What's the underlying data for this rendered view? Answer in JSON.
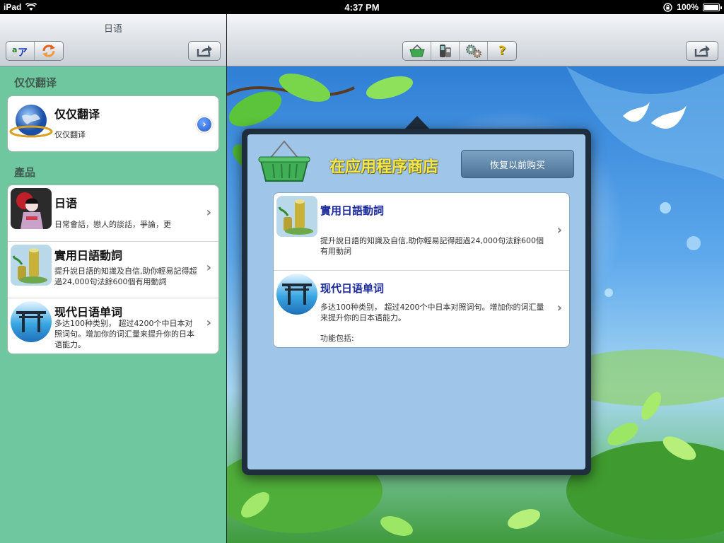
{
  "status_bar": {
    "device": "iPad",
    "time": "4:37 PM",
    "battery": "100%",
    "battery_level": 1.0
  },
  "master": {
    "title": "日语",
    "buttons": {
      "translate_icon": "translate-icon",
      "refresh_icon": "refresh-icon",
      "share_icon": "share-icon"
    },
    "sections": [
      {
        "header": "仅仅翻译",
        "items": [
          {
            "title": "仅仅翻译",
            "desc": "仅仅翻译",
            "icon": "globe-icon"
          }
        ]
      },
      {
        "header": "產品",
        "items": [
          {
            "title": "日语",
            "desc": "日常會話，戀人的談話，爭論，更",
            "icon": "geisha-icon"
          },
          {
            "title": "實用日語動詞",
            "desc": "提升說日語的知識及自信,助你輕易記得超過24,000句法餘600個有用動詞",
            "icon": "bamboo-icon"
          },
          {
            "title": "现代日语单词",
            "desc": "多达100种类别， 超过4200个中日本对照词句。增加你的词汇量来提升你的日本语能力。",
            "icon": "torii-icon"
          }
        ]
      }
    ]
  },
  "detail": {
    "toolbar": {
      "icons": [
        "basket-icon",
        "translate-device-icon",
        "gears-icon",
        "help-icon"
      ],
      "help_label": "?"
    },
    "share_icon": "share-icon"
  },
  "popover": {
    "title": "在应用程序商店",
    "restore_label": "恢复以前购买",
    "items": [
      {
        "title": "實用日語動詞",
        "desc": "提升說日語的知識及自信,助你輕易記得超過24,000句法餘600個有用動詞",
        "icon": "bamboo-icon"
      },
      {
        "title": "现代日语单词",
        "desc": "多达100种类别， 超过4200个中日本对照词句。增加你的词汇量来提升你的日本语能力。",
        "extra": "功能包括:",
        "icon": "torii-icon"
      }
    ]
  },
  "colors": {
    "sidebar_bg": "#6fc7a0",
    "popover_bg": "#9fc5e8",
    "store_title": "#f5e64a",
    "item_title_blue": "#1a2a9a"
  }
}
